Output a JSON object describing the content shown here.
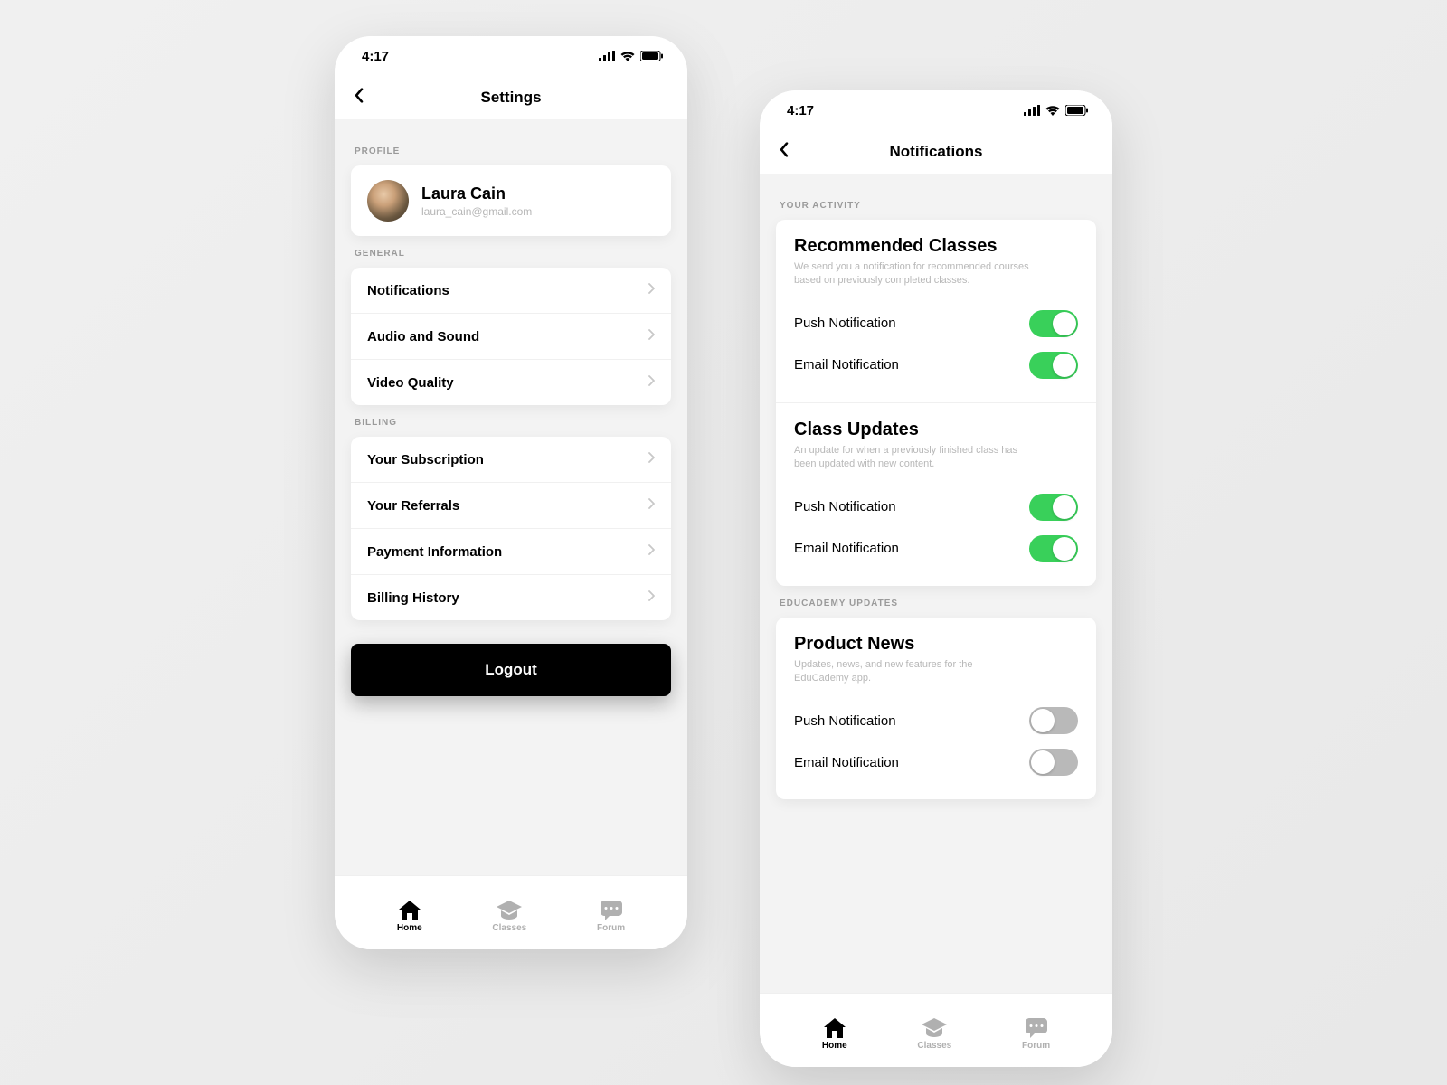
{
  "status": {
    "time": "4:17"
  },
  "left": {
    "header_title": "Settings",
    "sections": {
      "profile_label": "PROFILE",
      "general_label": "GENERAL",
      "billing_label": "BILLING"
    },
    "profile": {
      "name": "Laura Cain",
      "email": "laura_cain@gmail.com"
    },
    "general": [
      {
        "label": "Notifications"
      },
      {
        "label": "Audio and Sound"
      },
      {
        "label": "Video Quality"
      }
    ],
    "billing": [
      {
        "label": "Your Subscription"
      },
      {
        "label": "Your Referrals"
      },
      {
        "label": "Payment Information"
      },
      {
        "label": "Billing History"
      }
    ],
    "logout": "Logout"
  },
  "right": {
    "header_title": "Notifications",
    "sections": {
      "activity_label": "YOUR ACTIVITY",
      "educademy_label": "EDUCADEMY UPDATES"
    },
    "groups": {
      "recommended": {
        "title": "Recommended Classes",
        "desc": "We send you a notification for recommended courses based on previously completed classes.",
        "push_label": "Push Notification",
        "email_label": "Email Notification",
        "push_on": true,
        "email_on": true
      },
      "updates": {
        "title": "Class Updates",
        "desc": "An update for when a previously finished class has been updated with new content.",
        "push_label": "Push Notification",
        "email_label": "Email Notification",
        "push_on": true,
        "email_on": true
      },
      "product": {
        "title": "Product News",
        "desc": "Updates, news, and new features for the EduCademy app.",
        "push_label": "Push Notification",
        "email_label": "Email Notification",
        "push_on": false,
        "email_on": false
      }
    }
  },
  "tabs": {
    "home": "Home",
    "classes": "Classes",
    "forum": "Forum"
  }
}
